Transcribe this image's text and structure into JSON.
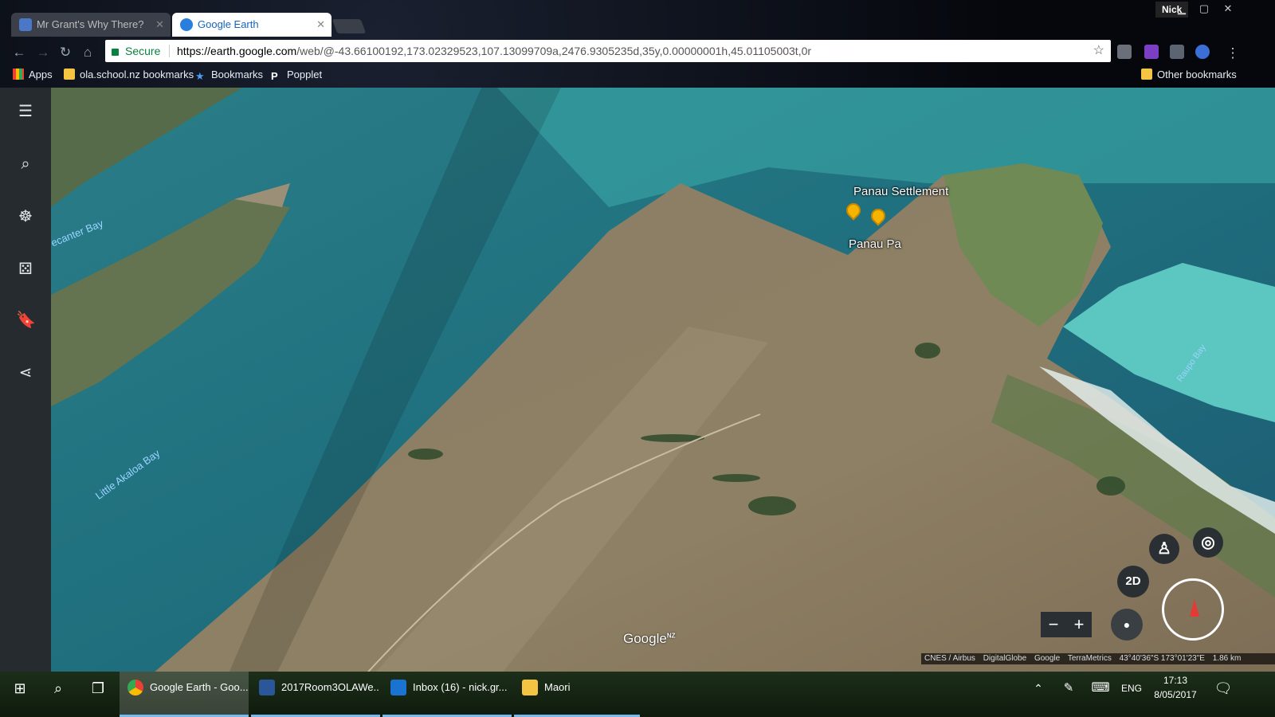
{
  "browser": {
    "tabs": [
      {
        "title": "Mr Grant's Why There?"
      },
      {
        "title": "Google Earth"
      }
    ],
    "profile": "Nick",
    "secure_label": "Secure",
    "url_host": "https://earth.google.com",
    "url_path": "/web/@-43.66100192,173.02329523,107.13099709a,2476.9305235d,35y,0.00000001h,45.01105003t,0r",
    "bookmarks": {
      "apps": "Apps",
      "ola": "ola.school.nz bookmarks",
      "bookmarks": "Bookmarks",
      "popplet": "Popplet",
      "other": "Other bookmarks"
    }
  },
  "map": {
    "places": {
      "settlement": "Panau Settlement",
      "pa": "Panau Pa"
    },
    "water_labels": {
      "ecanter": "ecanter Bay",
      "little_akaloa": "Little Akaloa Bay",
      "raupo": "Raupo Bay"
    },
    "buttons": {
      "toggle_2d": "2D",
      "zoom_out": "−",
      "zoom_in": "+"
    },
    "logo": "Google",
    "logo_sup": "NZ",
    "attribution": [
      "CNES / Airbus",
      "DigitalGlobe",
      "Google",
      "TerraMetrics",
      "43°40'36\"S 173°01'23\"E",
      "1.86 km"
    ]
  },
  "taskbar": {
    "items": [
      {
        "label": "Google Earth - Goo..."
      },
      {
        "label": "2017Room3OLAWe..."
      },
      {
        "label": "Inbox (16) - nick.gr..."
      },
      {
        "label": "Maori"
      }
    ],
    "language": "ENG",
    "time": "17:13",
    "date": "8/05/2017"
  }
}
